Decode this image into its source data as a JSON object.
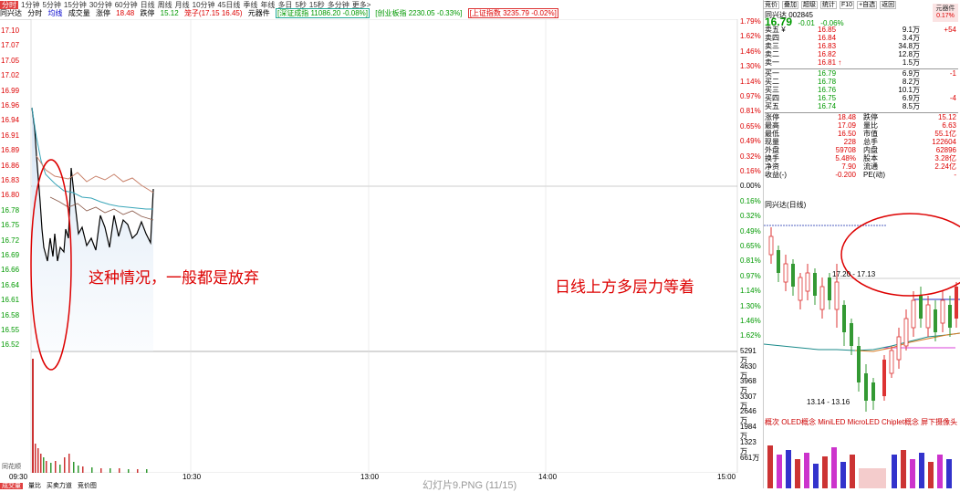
{
  "top_tabs": [
    "分时",
    "1分钟",
    "5分钟",
    "15分钟",
    "30分钟",
    "60分钟",
    "日线",
    "周线",
    "月线",
    "10分钟",
    "45日线",
    "季线",
    "年线",
    "多日",
    "5秒",
    "15秒",
    "多分钟",
    "更多>"
  ],
  "info_bar": {
    "name": "同兴达",
    "mode": "分时",
    "avg_label": "均线",
    "vol_label": "成交量",
    "limit_up_label": "涨停",
    "limit_up": "18.48",
    "limit_down_label": "跌停",
    "limit_down": "15.12",
    "bid_ask": "笼子(17.15 16.45)",
    "sector": "元器件",
    "idx1": "[深证成指 11086.20 -0.08%]",
    "idx2": "[创业板指 2230.05 -0.33%]",
    "idx3": "[上证指数 3235.79 -0.02%]"
  },
  "left_axis": [
    "17.10",
    "17.07",
    "17.05",
    "17.02",
    "16.99",
    "16.96",
    "16.94",
    "16.91",
    "16.89",
    "16.86",
    "16.83",
    "16.80",
    "16.78",
    "16.75",
    "16.72",
    "16.69",
    "16.66",
    "16.64",
    "16.61",
    "16.58",
    "16.55",
    "16.52"
  ],
  "right_axis_pct": [
    "1.79%",
    "1.62%",
    "1.46%",
    "1.30%",
    "1.14%",
    "0.97%",
    "0.81%",
    "0.65%",
    "0.49%",
    "0.32%",
    "0.16%",
    "0.00%",
    "0.16%",
    "0.32%",
    "0.49%",
    "0.65%",
    "0.81%",
    "0.97%",
    "1.14%",
    "1.30%",
    "1.46%",
    "1.62%"
  ],
  "volume_axis": [
    "5291万",
    "4630万",
    "3968万",
    "3307万",
    "2646万",
    "1984万",
    "1323万",
    "661万"
  ],
  "time_axis": [
    "09:30",
    "10:30",
    "13:00",
    "14:00",
    "15:00"
  ],
  "bottom_tabs": [
    "成交量",
    "量比",
    "买卖力道",
    "竞价图"
  ],
  "left_footer": "同花顺",
  "annotations": {
    "left": "这种情况，一般都是放弃",
    "right": "日线上方多层力等着"
  },
  "watermark": "幻灯片9.PNG (11/15)",
  "right_panel": {
    "toolbar": [
      "竞价",
      "叠加",
      "超级",
      "统计",
      "F10",
      "+自选",
      "返回"
    ],
    "title_name": "同兴达",
    "title_code": "002845",
    "price": "16.79",
    "change": "-0.01",
    "change_pct": "-0.06%",
    "sector_badge": "元器件",
    "sector_pct": "0.17%",
    "sell": [
      {
        "label": "卖五 ¥",
        "price": "16.85",
        "vol": "9.1万",
        "diff": "+54"
      },
      {
        "label": "卖四",
        "price": "16.84",
        "vol": "3.4万",
        "diff": ""
      },
      {
        "label": "卖三",
        "price": "16.83",
        "vol": "34.8万",
        "diff": ""
      },
      {
        "label": "卖二",
        "price": "16.82",
        "vol": "12.8万",
        "diff": ""
      },
      {
        "label": "卖一",
        "price": "16.81 ↑",
        "vol": "1.5万",
        "diff": ""
      }
    ],
    "buy": [
      {
        "label": "买一",
        "price": "16.79",
        "vol": "6.9万",
        "diff": "-1"
      },
      {
        "label": "买二",
        "price": "16.78",
        "vol": "8.2万",
        "diff": ""
      },
      {
        "label": "买三",
        "price": "16.76",
        "vol": "10.1万",
        "diff": ""
      },
      {
        "label": "买四",
        "price": "16.75",
        "vol": "6.9万",
        "diff": "-4"
      },
      {
        "label": "买五",
        "price": "16.74",
        "vol": "8.5万",
        "diff": ""
      }
    ],
    "stats": [
      {
        "k1": "涨停",
        "v1": "18.48",
        "k2": "跌停",
        "v2": "15.12"
      },
      {
        "k1": "最高",
        "v1": "17.09",
        "k2": "量比",
        "v2": "6.63"
      },
      {
        "k1": "最低",
        "v1": "16.50",
        "k2": "市值",
        "v2": "55.1亿"
      },
      {
        "k1": "现量",
        "v1": "228",
        "k2": "总手",
        "v2": "122604"
      },
      {
        "k1": "外盘",
        "v1": "59708",
        "k2": "内盘",
        "v2": "62896"
      },
      {
        "k1": "换手",
        "v1": "5.48%",
        "k2": "股本",
        "v2": "3.28亿"
      },
      {
        "k1": "净资",
        "v1": "7.90",
        "k2": "流通",
        "v2": "2.24亿"
      },
      {
        "k1": "收益(-)",
        "v1": "-0.200",
        "k2": "PE(动)",
        "v2": "-"
      }
    ],
    "daily_title": "同兴达(日线)",
    "daily_label_top": "17.20 - 17.13",
    "daily_label_bottom": "13.14 - 13.16",
    "concept_bar": "概次 OLED概念 MiniLED MicroLED Chiplet概念 屏下摄像头"
  }
}
